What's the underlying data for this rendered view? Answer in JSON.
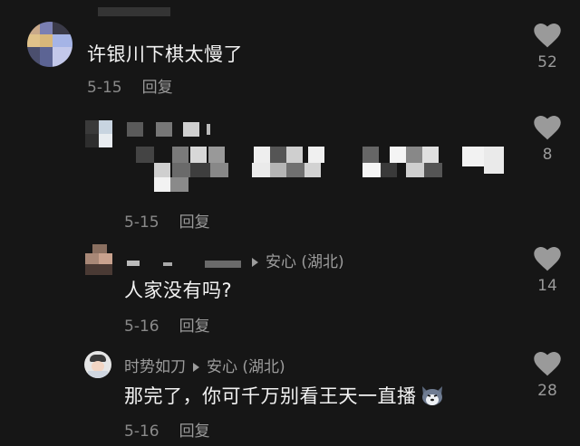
{
  "comments": [
    {
      "username": "",
      "text": "许银川下棋太慢了",
      "date": "5-15",
      "reply_label": "回复",
      "likes": "52"
    },
    {
      "username": "",
      "text": "",
      "date": "5-15",
      "reply_label": "回复",
      "likes": "8"
    },
    {
      "username": "",
      "reply_to": "安心 (湖北)",
      "text": "人家没有吗?",
      "date": "5-16",
      "reply_label": "回复",
      "likes": "14"
    },
    {
      "username": "时势如刀",
      "reply_to": "安心 (湖北)",
      "text": "那完了，你可千万别看王天一直播",
      "date": "5-16",
      "reply_label": "回复",
      "likes": "28"
    }
  ],
  "colors": {
    "background": "#161616",
    "text_primary": "#f2f2f2",
    "text_secondary": "#8a8a8a",
    "like_icon": "#9a9a9a"
  },
  "icons": {
    "like": "heart-icon",
    "reply_arrow": "triangle-right-icon",
    "emoji": "husky-face-emoji"
  }
}
